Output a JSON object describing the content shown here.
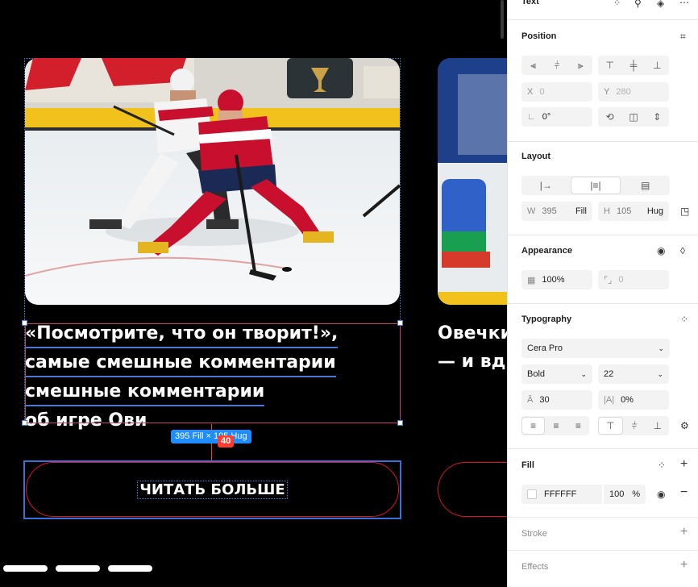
{
  "canvas": {
    "headline_lines": [
      "«Посмотрите, что он творит!»,",
      "самые смешные комментарии",
      "смешные комментарии",
      "об игре Ови"
    ],
    "headline2_lines": [
      "Овечки",
      "— и вд"
    ],
    "size_badge": "395 Fill × 105 Hug",
    "gap_badge": "40",
    "button_label": "ЧИТАТЬ БОЛЬШЕ"
  },
  "panel": {
    "header": {
      "title": "Text"
    },
    "position": {
      "title": "Position",
      "x_label": "X",
      "x_value": "0",
      "y_label": "Y",
      "y_value": "280",
      "rotation": "0°"
    },
    "layout": {
      "title": "Layout",
      "w_label": "W",
      "w_value": "395",
      "w_mode": "Fill",
      "h_label": "H",
      "h_value": "105",
      "h_mode": "Hug"
    },
    "appearance": {
      "title": "Appearance",
      "opacity": "100%",
      "radius": "0"
    },
    "typography": {
      "title": "Typography",
      "font_family": "Cera Pro",
      "font_weight": "Bold",
      "font_size": "22",
      "line_height": "30",
      "letter_spacing": "0%"
    },
    "fill": {
      "title": "Fill",
      "hex": "FFFFFF",
      "opacity": "100",
      "unit": "%"
    },
    "stroke": {
      "title": "Stroke"
    },
    "effects": {
      "title": "Effects"
    }
  },
  "colors": {
    "selection_blue": "#4a78d6",
    "badge_blue": "#1f8cff",
    "gap_red": "#ff3b2f",
    "button_border": "#e0102a"
  }
}
